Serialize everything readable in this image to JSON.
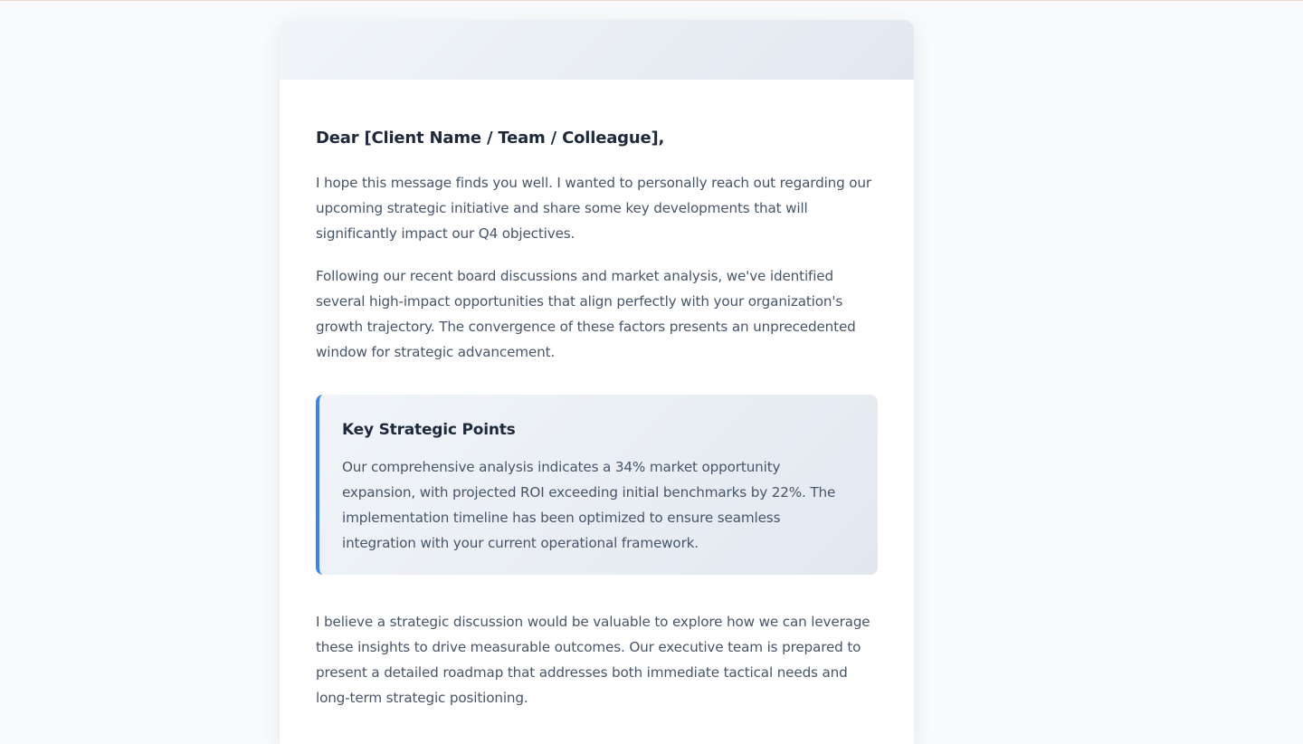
{
  "letter": {
    "greeting": "Dear [Client Name / Team / Colleague],",
    "paragraphs": [
      "I hope this message finds you well. I wanted to personally reach out regarding our upcoming strategic initiative and share some key developments that will significantly impact our Q4 objectives.",
      "Following our recent board discussions and market analysis, we've identified several high-impact opportunities that align perfectly with your organization's growth trajectory. The convergence of these factors presents an unprecedented window for strategic advancement."
    ],
    "highlight": {
      "title": "Key Strategic Points",
      "text": "Our comprehensive analysis indicates a 34% market opportunity expansion, with projected ROI exceeding initial benchmarks by 22%. The implementation timeline has been optimized to ensure seamless integration with your current operational framework."
    },
    "closing_paragraph": "I believe a strategic discussion would be valuable to explore how we can leverage these insights to drive measurable outcomes. Our executive team is prepared to present a detailed roadmap that addresses both immediate tactical needs and long-term strategic positioning."
  },
  "colors": {
    "page_background": "#f8fafc",
    "accent": "#3b82f6",
    "heading": "#1e293b",
    "body_text": "#475569"
  }
}
